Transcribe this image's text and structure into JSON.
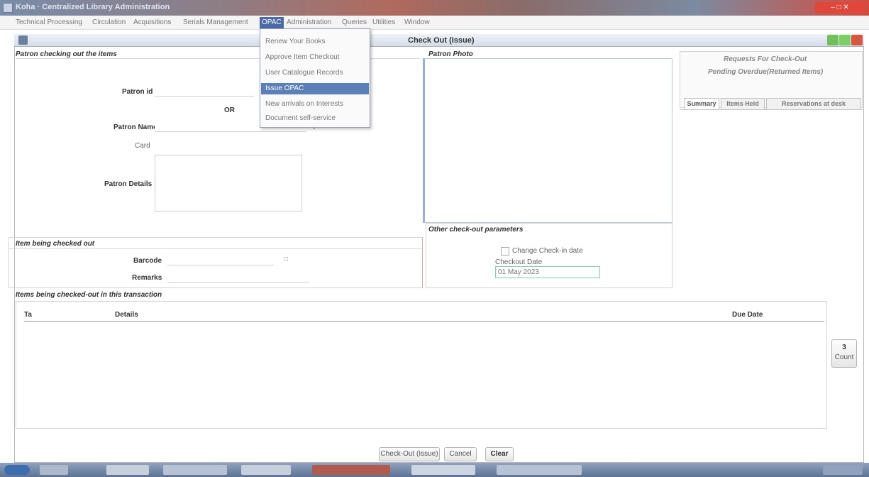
{
  "window": {
    "title": "Koha · Centralized Library Administration"
  },
  "menubar": {
    "items": [
      "Technical Processing",
      "Circulation",
      "Acquisitions",
      "Serials Management",
      "OPAC",
      "Administration",
      "Queries",
      "Utilities",
      "Window"
    ]
  },
  "opac_menu": {
    "items": [
      "Renew Your Books",
      "Approve Item Checkout",
      "User Catalogue Records",
      "Issue OPAC",
      "New arrivals on Interests",
      "Document self-service"
    ]
  },
  "frame": {
    "title": "Check Out (Issue)"
  },
  "patron_section": {
    "title": "Patron checking out the items",
    "patron_id_label": "Patron id",
    "or_label": "OR",
    "patron_name_label": "Patron Name",
    "card_label": "Card",
    "details_label": "Patron Details"
  },
  "photo_section": {
    "title": "Patron Photo"
  },
  "right_panel": {
    "title_line1": "Requests For Check-Out",
    "title_line2": "Pending Overdue(Returned Items)",
    "tabs": [
      "Summary",
      "Items Held",
      "Reservations at desk"
    ]
  },
  "items_section": {
    "title": "Item being checked out",
    "barcode_label": "Barcode",
    "remarks_label": "Remarks"
  },
  "other_params": {
    "title": "Other check-out parameters",
    "change_checkin_label": "Change Check-in date",
    "checkin_date_label": "Checkout Date",
    "checkin_date_value": "01 May 2023"
  },
  "transaction_section": {
    "title": "Items being checked-out in this transaction",
    "columns": [
      "Ta",
      "Details",
      "Due Date"
    ]
  },
  "side_buttons": {
    "count_label": "Count",
    "count_value": "3"
  },
  "actions": {
    "checkout_label": "Check-Out (Issue)",
    "cancel_label": "Cancel",
    "clear_label": "Clear"
  }
}
